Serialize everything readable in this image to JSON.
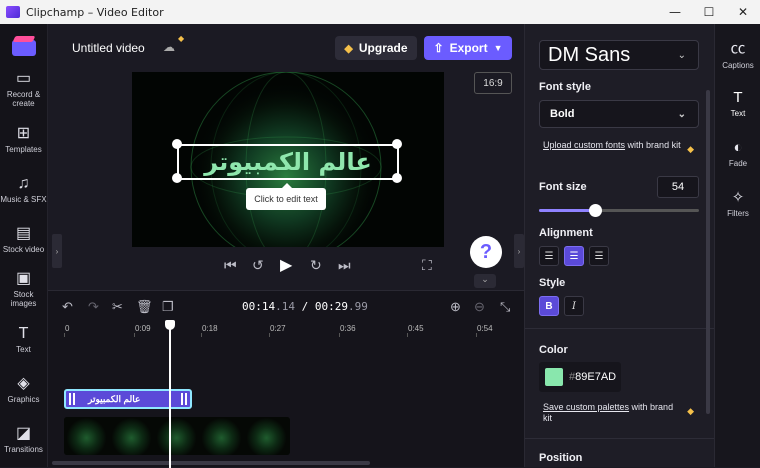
{
  "window": {
    "title": "Clipchamp – Video Editor",
    "minimize": "—",
    "maximize": "☐",
    "close": "✕"
  },
  "sidebar": {
    "items": [
      {
        "label": "Record & create",
        "icon": "camera-icon"
      },
      {
        "label": "Templates",
        "icon": "templates-icon"
      },
      {
        "label": "Music & SFX",
        "icon": "music-icon"
      },
      {
        "label": "Stock video",
        "icon": "film-icon"
      },
      {
        "label": "Stock images",
        "icon": "image-icon"
      },
      {
        "label": "Text",
        "icon": "text-icon"
      },
      {
        "label": "Graphics",
        "icon": "shapes-icon"
      },
      {
        "label": "Transitions",
        "icon": "transitions-icon"
      }
    ]
  },
  "header": {
    "project_name": "Untitled video",
    "upgrade_label": "Upgrade",
    "export_label": "Export",
    "aspect_ratio": "16:9"
  },
  "preview": {
    "overlay_text": "عالم الكمبيوتر",
    "tooltip": "Click to edit text"
  },
  "timeline": {
    "current_time_main": "00:14",
    "current_time_ms": ".14",
    "separator": " / ",
    "total_time_main": "00:29",
    "total_time_ms": ".99",
    "ticks": [
      "0",
      "0:09",
      "0:18",
      "0:27",
      "0:36",
      "0:45",
      "0:54"
    ],
    "text_clip_label": "عالم الكمبيوتر",
    "video_frames": 5
  },
  "panel": {
    "font_family": "DM Sans",
    "font_style_label": "Font style",
    "font_style_value": "Bold",
    "upload_fonts_link": "Upload custom fonts",
    "upload_fonts_suffix": " with brand kit",
    "font_size_label": "Font size",
    "font_size_value": "54",
    "font_size_fraction": 0.35,
    "alignment_label": "Alignment",
    "style_label": "Style",
    "bold_glyph": "B",
    "italic_glyph": "I",
    "color_label": "Color",
    "color_hash": "#",
    "color_hex": "89E7AD",
    "color_value": "#89E7AD",
    "save_palettes_link": "Save custom palettes",
    "save_palettes_suffix": " with brand kit",
    "position_label": "Position"
  },
  "rail": {
    "items": [
      {
        "label": "Captions",
        "icon": "captions-icon"
      },
      {
        "label": "Text",
        "icon": "text-icon",
        "active": true
      },
      {
        "label": "Fade",
        "icon": "fade-icon"
      },
      {
        "label": "Filters",
        "icon": "filters-icon"
      }
    ]
  },
  "colors": {
    "accent": "#6b5cff",
    "text_green": "#89E7AD",
    "gem": "#f5c04a"
  }
}
